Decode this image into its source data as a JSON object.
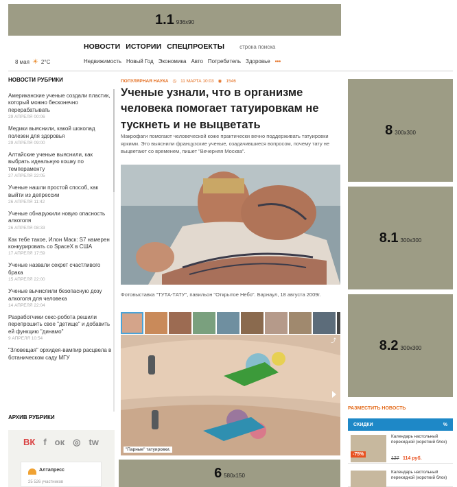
{
  "ads": {
    "top": {
      "num": "1.1",
      "size": "936x90"
    },
    "right1": {
      "num": "8",
      "size": "300x300"
    },
    "right2": {
      "num": "8.1",
      "size": "300x300"
    },
    "right3": {
      "num": "8.2",
      "size": "300x300"
    },
    "bottom": {
      "num": "6",
      "size": "580x150"
    }
  },
  "header": {
    "nav": [
      "НОВОСТИ",
      "ИСТОРИИ",
      "СПЕЦПРОЕКТЫ"
    ],
    "search_label": "строка поиска",
    "subnav": [
      "Недвижимость",
      "Новый Год",
      "Экономика",
      "Авто",
      "Потребитель",
      "Здоровье"
    ],
    "more": "•••",
    "weather": {
      "date": "8 мая",
      "temp": "2°C",
      "icon": "sun-cloud-icon"
    }
  },
  "sidebar": {
    "heading": "НОВОСТИ РУБРИКИ",
    "items": [
      {
        "title": "Американские ученые создали пластик, который можно бесконечно перерабатывать",
        "date": "29 апреля 00:06"
      },
      {
        "title": "Медики выяснили, какой шоколад полезен для здоровья",
        "date": "29 апреля 09:00"
      },
      {
        "title": "Алтайские ученые выяснили, как выбрать идеальную кошку по темпераменту",
        "date": "27 апреля 22:05"
      },
      {
        "title": "Ученые нашли простой способ, как выйти из депрессии",
        "date": "26 апреля 11:42"
      },
      {
        "title": "Ученые обнаружили новую опасность алкоголя",
        "date": "26 апреля 08:33"
      },
      {
        "title": "Как тебе такое, Илон Маск: S7 намерен конкурировать со SpaceX в США",
        "date": "17 апреля 17:59"
      },
      {
        "title": "Ученые назвали секрет счастливого брака",
        "date": "15 апреля 22:00"
      },
      {
        "title": "Ученые вычислили безопасную дозу алкоголя для человека",
        "date": "14 апреля 22:04"
      },
      {
        "title": "Разработчики секс-робота решили перепрошить свое \"детище\" и добавить ей функцию \"динамо\"",
        "date": "9 апреля 10:54"
      },
      {
        "title": "\"Зловещая\" орхидея-вампир расцвела в ботаническом саду МГУ",
        "date": ""
      }
    ],
    "archive": "АРХИВ РУБРИКИ",
    "social": [
      "ВК",
      "f",
      "ок",
      "◎",
      "tw"
    ],
    "partner": {
      "name": "Алтапресс",
      "subscribers": "25 526 участников"
    }
  },
  "article": {
    "rubric": "ПОПУЛЯРНАЯ НАУКА",
    "date": "11 МАРТА 10:03",
    "views": "1546",
    "title": "Ученые узнали, что в организме человека помогает татуировкам не тускнеть и не выцветать",
    "lead": "Макрофаги помогают человеческой коже практически вечно поддерживать татуировки яркими. Это выяснили французские ученые, озадачившиеся вопросом, почему тату не выцветают со временем, пишет \"Вечерняя Москва\".",
    "photo_caption": "Фотовыставка \"ТУТА-ТАТУ\", павильон \"Открытое Небо\". Барнаул, 18 августа 2009г.",
    "gallery_caption": "\"Парные\" татуировки."
  },
  "right": {
    "place_news": "РАЗМЕСТИТЬ НОВОСТЬ",
    "discounts": {
      "heading": "СКИДКИ",
      "symbol": "%"
    },
    "products": [
      {
        "title": "Календарь настольный перекидной (короткий блок)",
        "old_price": "127",
        "new_price": "114 руб.",
        "badge": "-75%"
      },
      {
        "title": "Календарь настольный перекидной (короткий блок)",
        "old_price": "",
        "new_price": "",
        "badge": ""
      }
    ]
  }
}
